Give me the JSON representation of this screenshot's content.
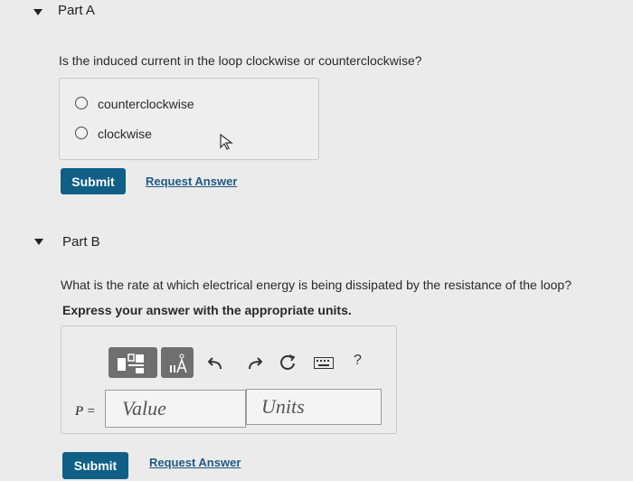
{
  "partA": {
    "title": "Part A",
    "question": "Is the induced current in the loop clockwise or counterclockwise?",
    "choices": [
      {
        "label": "counterclockwise"
      },
      {
        "label": "clockwise"
      }
    ],
    "submit_label": "Submit",
    "request_label": "Request Answer"
  },
  "partB": {
    "title": "Part B",
    "question": "What is the rate at which electrical energy is being dissipated by the resistance of the loop?",
    "instruction": "Express your answer with the appropriate units.",
    "toolbar": {
      "help_label": "?"
    },
    "variable_label": "P =",
    "value_placeholder": "Value",
    "units_placeholder": "Units",
    "submit_label": "Submit",
    "request_label": "Request Answer"
  }
}
